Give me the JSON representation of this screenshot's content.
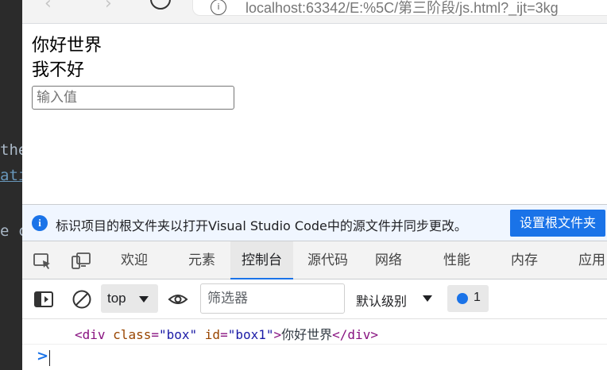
{
  "ide_fragment": {
    "line1": "the",
    "line2": "ati",
    "line3": "e c"
  },
  "browser": {
    "url": "localhost:63342/E:%5C/第三阶段/js.html?_ijt=3kg"
  },
  "page": {
    "box1_text": "你好世界",
    "box2_text": "我不好",
    "input_placeholder": "输入值"
  },
  "devtools": {
    "infobar": {
      "message": "标识项目的根文件夹以打开Visual Studio Code中的源文件并同步更改。",
      "button_label": "设置根文件夹"
    },
    "tabs": [
      {
        "label": "欢迎"
      },
      {
        "label": "元素"
      },
      {
        "label": "控制台"
      },
      {
        "label": "源代码"
      },
      {
        "label": "网络"
      },
      {
        "label": "性能"
      },
      {
        "label": "内存"
      },
      {
        "label": "应用"
      }
    ],
    "active_tab": "控制台",
    "console_toolbar": {
      "context": "top",
      "filter_placeholder": "筛选器",
      "log_level": "默认级别",
      "issues_count": "1"
    },
    "console_output": {
      "open_tag_start": "<div ",
      "attr1_name": "class",
      "attr1_eq": "=",
      "attr1_value": "\"box\"",
      "attr2_name": "id",
      "attr2_eq": "=",
      "attr2_value": "\"box1\"",
      "open_tag_end": ">",
      "inner_text": "你好世界",
      "close_tag": "</div>"
    },
    "prompt_symbol": ">"
  },
  "colors": {
    "accent": "#1a73e8",
    "infobar_bg": "#f0f6ff",
    "tag": "#881280",
    "attr_name": "#994500",
    "attr_value": "#1a1aa6"
  }
}
